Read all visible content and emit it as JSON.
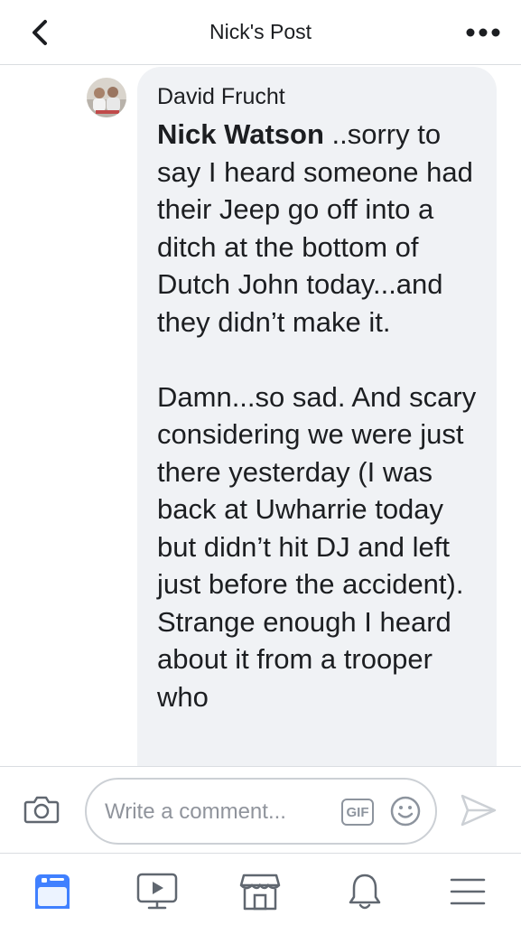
{
  "header": {
    "back_icon": "chevron-left-icon",
    "title": "Nick's Post",
    "more_icon": "more-dots-icon"
  },
  "comment": {
    "author": "David Frucht",
    "mention": "Nick Watson",
    "text_part1": " ..sorry to say I heard someone had their Jeep go off into a ditch at the bottom of Dutch John today...and they didn’t make it.",
    "text_part2": "Damn...so sad.  And scary considering we were just there yesterday (I was back at Uwharrie today but didn’t hit DJ and left just before the accident).  Strange enough I heard about it from a trooper who"
  },
  "composer": {
    "camera_icon": "camera-icon",
    "placeholder": "Write a comment...",
    "gif_label": "GIF",
    "emoji_icon": "emoji-icon",
    "send_icon": "send-icon"
  },
  "tabbar": {
    "items": [
      {
        "icon": "news-feed-icon",
        "active": true
      },
      {
        "icon": "watch-icon",
        "active": false
      },
      {
        "icon": "marketplace-icon",
        "active": false
      },
      {
        "icon": "notifications-bell-icon",
        "active": false
      },
      {
        "icon": "menu-icon",
        "active": false
      }
    ]
  },
  "colors": {
    "accent": "#4080ff",
    "bubble": "#f0f2f5",
    "icon_gray": "#606770",
    "divider": "#dadde1"
  }
}
